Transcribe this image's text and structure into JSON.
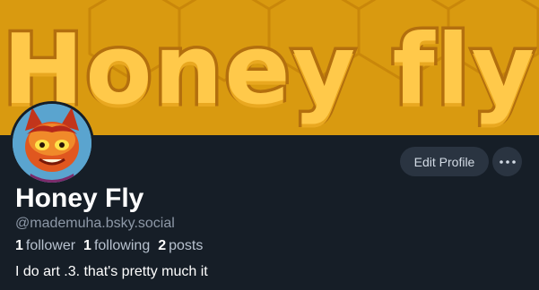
{
  "colors": {
    "background": "#161e27",
    "banner": "#d99a10",
    "button": "#2a3441",
    "text_primary": "#ffffff",
    "text_secondary": "#8d98a7"
  },
  "banner": {
    "artwork_text": "Honey fly"
  },
  "profile": {
    "display_name": "Honey Fly",
    "handle": "@mademuha.bsky.social",
    "bio": "I do art .3. that's pretty much it"
  },
  "actions": {
    "edit_profile_label": "Edit Profile",
    "more_icon": "ellipsis-icon"
  },
  "stats": {
    "followers_count": "1",
    "followers_label": "follower",
    "following_count": "1",
    "following_label": "following",
    "posts_count": "2",
    "posts_label": "posts"
  }
}
